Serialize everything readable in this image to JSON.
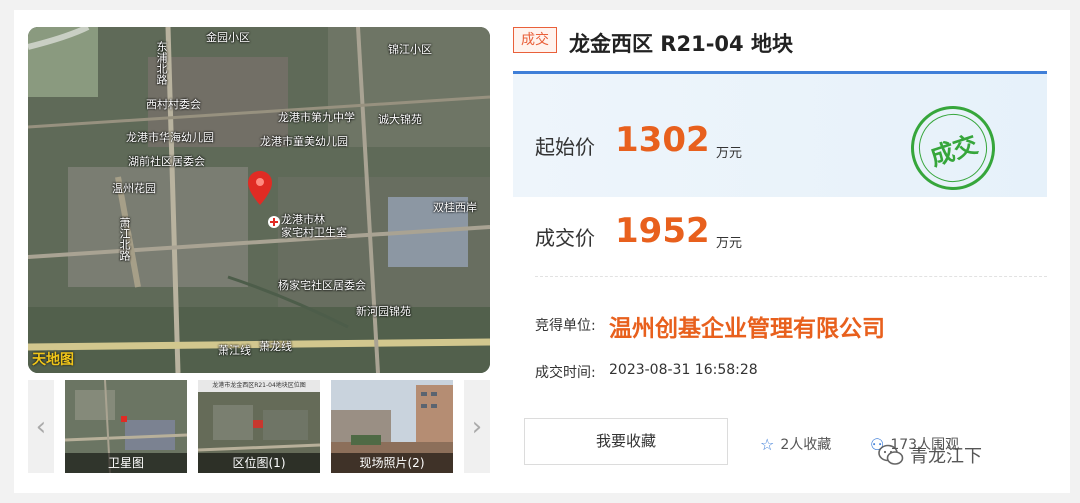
{
  "map": {
    "labels": [
      "金园小区",
      "东浦北路",
      "西村村委会",
      "龙港市第九中学",
      "龙港市华海幼儿园",
      "龙港市童美幼儿园",
      "湖前社区居委会",
      "温州花园",
      "双桂西岸",
      "萧江北路",
      "龙港市林",
      "家宅村卫生室",
      "杨家宅社区居委会",
      "新河园锦苑",
      "萧江线",
      "萧龙线",
      "锦江小区",
      "诚大锦苑"
    ],
    "provider": "天地图"
  },
  "thumbnails": [
    {
      "caption": "卫星图"
    },
    {
      "caption": "区位图(1)",
      "inner_title": "龙港市龙金西区R21-04地块区位图"
    },
    {
      "caption": "现场照片(2)"
    }
  ],
  "status_badge": "成交",
  "title": "龙金西区 R21-04 地块",
  "start_price": {
    "label": "起始价",
    "value": "1302",
    "unit": "万元"
  },
  "deal_price": {
    "label": "成交价",
    "value": "1952",
    "unit": "万元"
  },
  "stamp": "成交",
  "winner": {
    "label": "竞得单位:",
    "value": "温州创基企业管理有限公司"
  },
  "deal_time": {
    "label": "成交时间:",
    "value": "2023-08-31 16:58:28"
  },
  "actions": {
    "favorite_button": "我要收藏",
    "favorites_count": "2人收藏",
    "visitors_count": "173人围观"
  },
  "watermark": "青龙江下",
  "colors": {
    "accent": "#e8601d",
    "blue": "#3f7fd8",
    "stamp_green": "#36a63b"
  }
}
